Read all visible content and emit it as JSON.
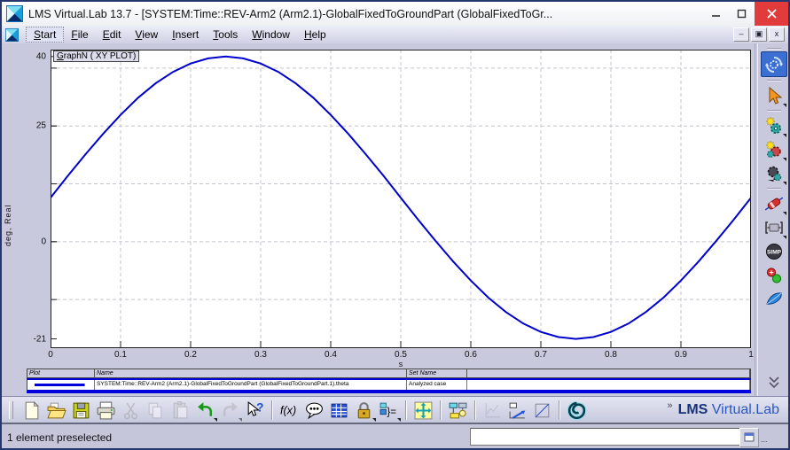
{
  "window": {
    "title": "LMS Virtual.Lab 13.7 - [SYSTEM:Time::REV-Arm2 (Arm2.1)-GlobalFixedToGroundPart (GlobalFixedToGr...",
    "controls": [
      "minimize",
      "maximize",
      "close"
    ]
  },
  "menubar": {
    "items": [
      {
        "label": "Start",
        "focused": true
      },
      {
        "label": "File"
      },
      {
        "label": "Edit"
      },
      {
        "label": "View"
      },
      {
        "label": "Insert"
      },
      {
        "label": "Tools"
      },
      {
        "label": "Window"
      },
      {
        "label": "Help"
      }
    ],
    "child_controls": [
      "minimize",
      "restore",
      "close"
    ]
  },
  "plot": {
    "title_chip": "GraphN ( XY PLOT)",
    "y_axis_label": "deg, Real",
    "x_axis_unit": "s"
  },
  "chart_data": {
    "type": "line",
    "title": "GraphN ( XY PLOT)",
    "xlabel": "s",
    "ylabel": "deg, Real",
    "xlim": [
      0,
      1
    ],
    "ylim": [
      -21,
      40
    ],
    "grid": "dashed",
    "legend_position": "bottom-table",
    "x_ticks": [
      0,
      0.1,
      0.2,
      0.3,
      0.4,
      0.5,
      0.6,
      0.7,
      0.8,
      0.9,
      1
    ],
    "x_tick_labels": [
      "0",
      "0.1",
      "0.2",
      "0.3",
      "0.4",
      "0.5",
      "0.6",
      "0.7",
      "0.8",
      "0.9",
      "1"
    ],
    "y_ticks": [
      {
        "v": 40,
        "label": "40"
      },
      {
        "v": 25,
        "label": "25"
      },
      {
        "v": 0,
        "label": "0"
      },
      {
        "v": -21,
        "label": "-21"
      }
    ],
    "y_gridlines": [
      37.5,
      25,
      12.5,
      0,
      -12.5
    ],
    "series": [
      {
        "name": "SYSTEM:Time::REV-Arm2 (Arm2.1)-GlobalFixedToGroundPart (GlobalFixedToGroundPart.1).theta",
        "set_name": "Analyzed case",
        "color": "#0000cc",
        "x": [
          0,
          0.025,
          0.05,
          0.075,
          0.1,
          0.125,
          0.15,
          0.175,
          0.2,
          0.225,
          0.25,
          0.275,
          0.3,
          0.325,
          0.35,
          0.375,
          0.4,
          0.425,
          0.45,
          0.475,
          0.5,
          0.525,
          0.55,
          0.575,
          0.6,
          0.625,
          0.65,
          0.675,
          0.7,
          0.725,
          0.75,
          0.775,
          0.8,
          0.825,
          0.85,
          0.875,
          0.9,
          0.925,
          0.95,
          0.975,
          1
        ],
        "y": [
          9.5,
          14.3,
          18.9,
          23.3,
          27.4,
          31.1,
          34.2,
          36.7,
          38.5,
          39.6,
          40,
          39.6,
          38.5,
          36.7,
          34.2,
          31.1,
          27.4,
          23.3,
          18.9,
          14.3,
          9.5,
          4.7,
          0.1,
          -4.3,
          -8.4,
          -12.1,
          -15.2,
          -17.7,
          -19.5,
          -20.6,
          -21,
          -20.6,
          -19.5,
          -17.7,
          -15.2,
          -12.1,
          -8.4,
          -4.3,
          0.1,
          4.7,
          9.5
        ]
      }
    ]
  },
  "legend_table": {
    "headers": [
      "Plot",
      "Name",
      "Set Name",
      ""
    ],
    "rows": [
      {
        "swatch_color": "#0000dd",
        "name": "SYSTEM:Time::REV-Arm2 (Arm2.1)-GlobalFixedToGroundPart (GlobalFixedToGroundPart.1).theta",
        "set_name": "Analyzed case"
      }
    ]
  },
  "right_toolbar": {
    "items": [
      {
        "sep": true
      },
      {
        "name": "refresh-gear-icon",
        "active": true
      },
      {
        "sep": true
      },
      {
        "name": "select-cursor-icon",
        "caret": true
      },
      {
        "sep": true
      },
      {
        "name": "mech-gear-sparkle-icon",
        "caret": true
      },
      {
        "name": "mech-gear-sparkle2-icon",
        "caret": true
      },
      {
        "name": "mech-gear-dark-icon",
        "caret": true
      },
      {
        "sep": true
      },
      {
        "name": "damper-icon",
        "caret": true
      },
      {
        "name": "joint-icon",
        "caret": true
      },
      {
        "name": "simp-icon"
      },
      {
        "name": "spheres-icon"
      },
      {
        "name": "shell-icon"
      }
    ],
    "overflow_icon": "chevron-double-down-icon"
  },
  "bottom_toolbar": {
    "items": [
      {
        "name": "new-document-icon"
      },
      {
        "name": "open-folder-icon"
      },
      {
        "name": "save-icon"
      },
      {
        "name": "print-icon"
      },
      {
        "name": "cut-icon",
        "disabled": true
      },
      {
        "name": "copy-icon",
        "disabled": true
      },
      {
        "name": "paste-icon",
        "disabled": true
      },
      {
        "name": "undo-icon",
        "caret": true
      },
      {
        "name": "redo-icon",
        "disabled": true,
        "caret": true
      },
      {
        "name": "help-cursor-icon"
      },
      {
        "sep": true
      },
      {
        "name": "function-icon"
      },
      {
        "name": "comment-icon"
      },
      {
        "name": "grid-icon"
      },
      {
        "name": "lock-icon",
        "caret": true
      },
      {
        "name": "formula-set-icon",
        "caret": true
      },
      {
        "sep": true
      },
      {
        "name": "fit-view-icon"
      },
      {
        "sep": true
      },
      {
        "name": "diagram-bulb-icon"
      },
      {
        "sep": true
      },
      {
        "name": "chart-disabled-icon",
        "disabled": true
      },
      {
        "name": "chart-update-icon"
      },
      {
        "name": "new-window-icon"
      },
      {
        "sep": true
      },
      {
        "name": "swirl-icon"
      }
    ],
    "overflow_label": "»",
    "logo": {
      "lms": "LMS",
      "rest": " Virtual.Lab"
    }
  },
  "statusbar": {
    "message": "1 element preselected",
    "input_value": "",
    "more_label": "..."
  }
}
